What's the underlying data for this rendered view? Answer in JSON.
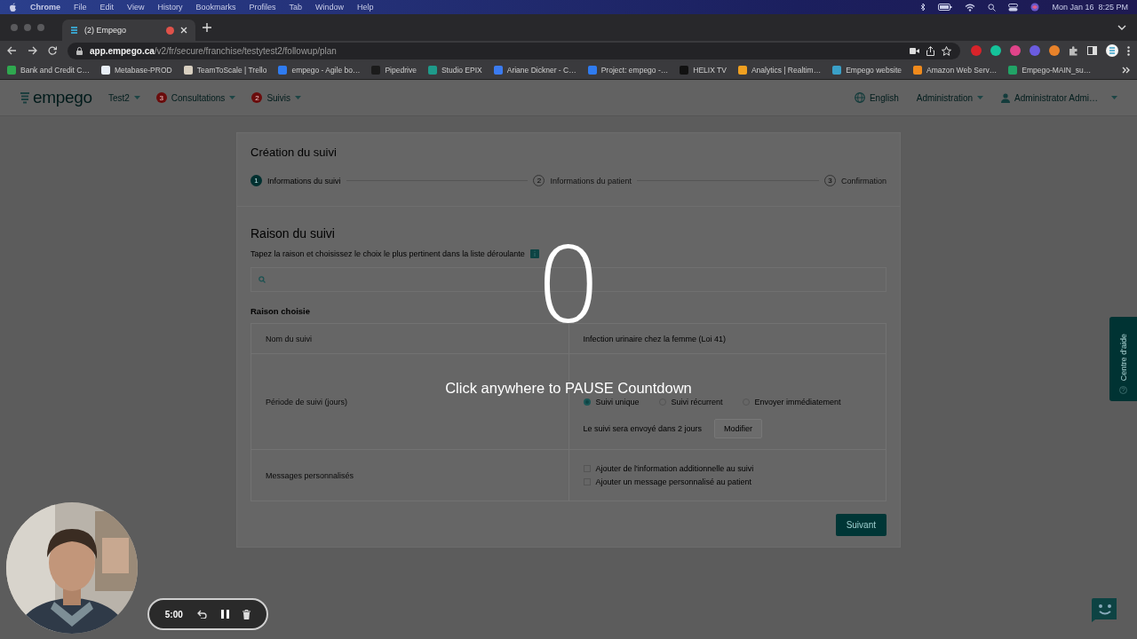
{
  "menubar": {
    "app": "Chrome",
    "menus": [
      "File",
      "Edit",
      "View",
      "History",
      "Bookmarks",
      "Profiles",
      "Tab",
      "Window",
      "Help"
    ],
    "clock": "Mon Jan 16  8:25 PM"
  },
  "browser": {
    "tab": {
      "title": "(2) Empego"
    },
    "url": {
      "host": "app.empego.ca",
      "path": "/v2/fr/secure/franchise/testytest2/followup/plan"
    },
    "bookmarks": [
      {
        "label": "Bank and Credit C…",
        "color": "#2fa84f"
      },
      {
        "label": "Metabase-PROD",
        "color": "#e8eef6"
      },
      {
        "label": "TeamToScale | Trello",
        "color": "#d8cfc0"
      },
      {
        "label": "empego - Agile bo…",
        "color": "#2f7bf0"
      },
      {
        "label": "Pipedrive",
        "color": "#1b1b1b"
      },
      {
        "label": "Studio EPIX",
        "color": "#1e9a8a"
      },
      {
        "label": "Ariane Dickner - C…",
        "color": "#3b7bf0"
      },
      {
        "label": "Project: empego -…",
        "color": "#2f7bf0"
      },
      {
        "label": "HELIX TV",
        "color": "#111111"
      },
      {
        "label": "Analytics | Realtim…",
        "color": "#f0a020"
      },
      {
        "label": "Empego website",
        "color": "#3aa0c8"
      },
      {
        "label": "Amazon Web Serv…",
        "color": "#f08a1c"
      },
      {
        "label": "Empego-MAIN_su…",
        "color": "#21a366"
      }
    ]
  },
  "app": {
    "logo": "empego",
    "nav": [
      {
        "label": "Test2"
      },
      {
        "label": "Consultations",
        "badge": "3"
      },
      {
        "label": "Suivis",
        "badge": "2"
      }
    ],
    "language": "English",
    "admin": "Administration",
    "user": "Administrator Admi…"
  },
  "form": {
    "title": "Création du suivi",
    "steps": [
      {
        "number": "1",
        "label": "Informations du suivi",
        "selected": true
      },
      {
        "number": "2",
        "label": "Informations du patient",
        "selected": false
      },
      {
        "number": "3",
        "label": "Confirmation",
        "selected": false
      }
    ],
    "section": "Raison du suivi",
    "hint": "Tapez la raison et choisissez le choix le plus pertinent dans la liste déroulante",
    "chosen_title": "Raison choisie",
    "rows": [
      {
        "kind": "text",
        "label": "Nom du suivi",
        "value": "Infection urinaire chez la femme (Loi 41)"
      },
      {
        "kind": "radios",
        "label": "Période de suivi (jours)",
        "options": [
          {
            "label": "Suivi unique",
            "selected": true
          },
          {
            "label": "Suivi récurrent",
            "selected": false
          },
          {
            "label": "Envoyer immédiatement",
            "selected": false
          }
        ],
        "note": "Le suivi sera envoyé dans 2 jours",
        "button": "Modifier"
      },
      {
        "kind": "checks",
        "label": "Messages personnalisés",
        "options": [
          {
            "label": "Ajouter de l'information additionnelle au suivi",
            "checked": false
          },
          {
            "label": "Ajouter un message personnalisé au patient",
            "checked": false
          }
        ]
      }
    ],
    "next": "Suivant"
  },
  "help_tab": "Centre d'aide",
  "recorder": {
    "countdown": "0",
    "message": "Click anywhere to PAUSE Countdown",
    "timer": "5:00"
  }
}
